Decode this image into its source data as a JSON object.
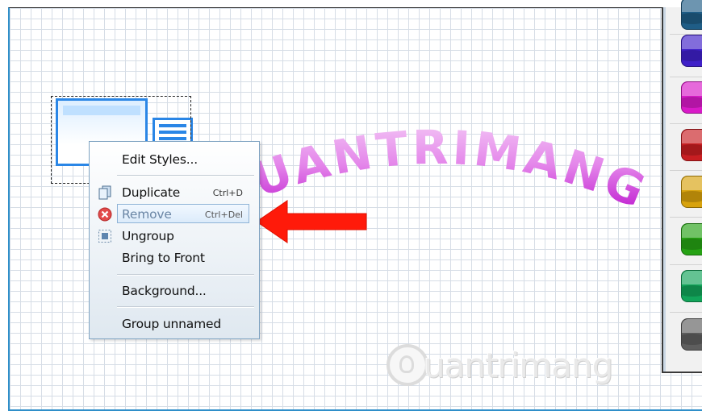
{
  "context_menu": {
    "items": [
      {
        "label": "Edit Styles...",
        "shortcut": "",
        "icon": "none",
        "state": "normal"
      },
      {
        "label": "Duplicate",
        "shortcut": "Ctrl+D",
        "icon": "duplicate-icon",
        "state": "normal"
      },
      {
        "label": "Remove",
        "shortcut": "Ctrl+Del",
        "icon": "remove-icon",
        "state": "hover-disabled"
      },
      {
        "label": "Ungroup",
        "shortcut": "",
        "icon": "ungroup-icon",
        "state": "normal"
      },
      {
        "label": "Bring to Front",
        "shortcut": "",
        "icon": "none",
        "state": "normal"
      },
      {
        "label": "Background...",
        "shortcut": "",
        "icon": "none",
        "state": "normal"
      },
      {
        "label": "Group unnamed",
        "shortcut": "",
        "icon": "none",
        "state": "normal"
      }
    ]
  },
  "canvas": {
    "wordart_text": "UANTRIMANG",
    "watermark_text": "uantrimang"
  },
  "palette": {
    "swatches": [
      "#1f5d86",
      "#3f20c8",
      "#d91ac8",
      "#c81e22",
      "#d8a20c",
      "#26a214",
      "#12a45a",
      "#5e5e5e"
    ]
  },
  "colors": {
    "accent_blue": "#2a86e6",
    "arrow_red": "#ff1a0a",
    "wordart_magenta": "#c21bd1"
  }
}
